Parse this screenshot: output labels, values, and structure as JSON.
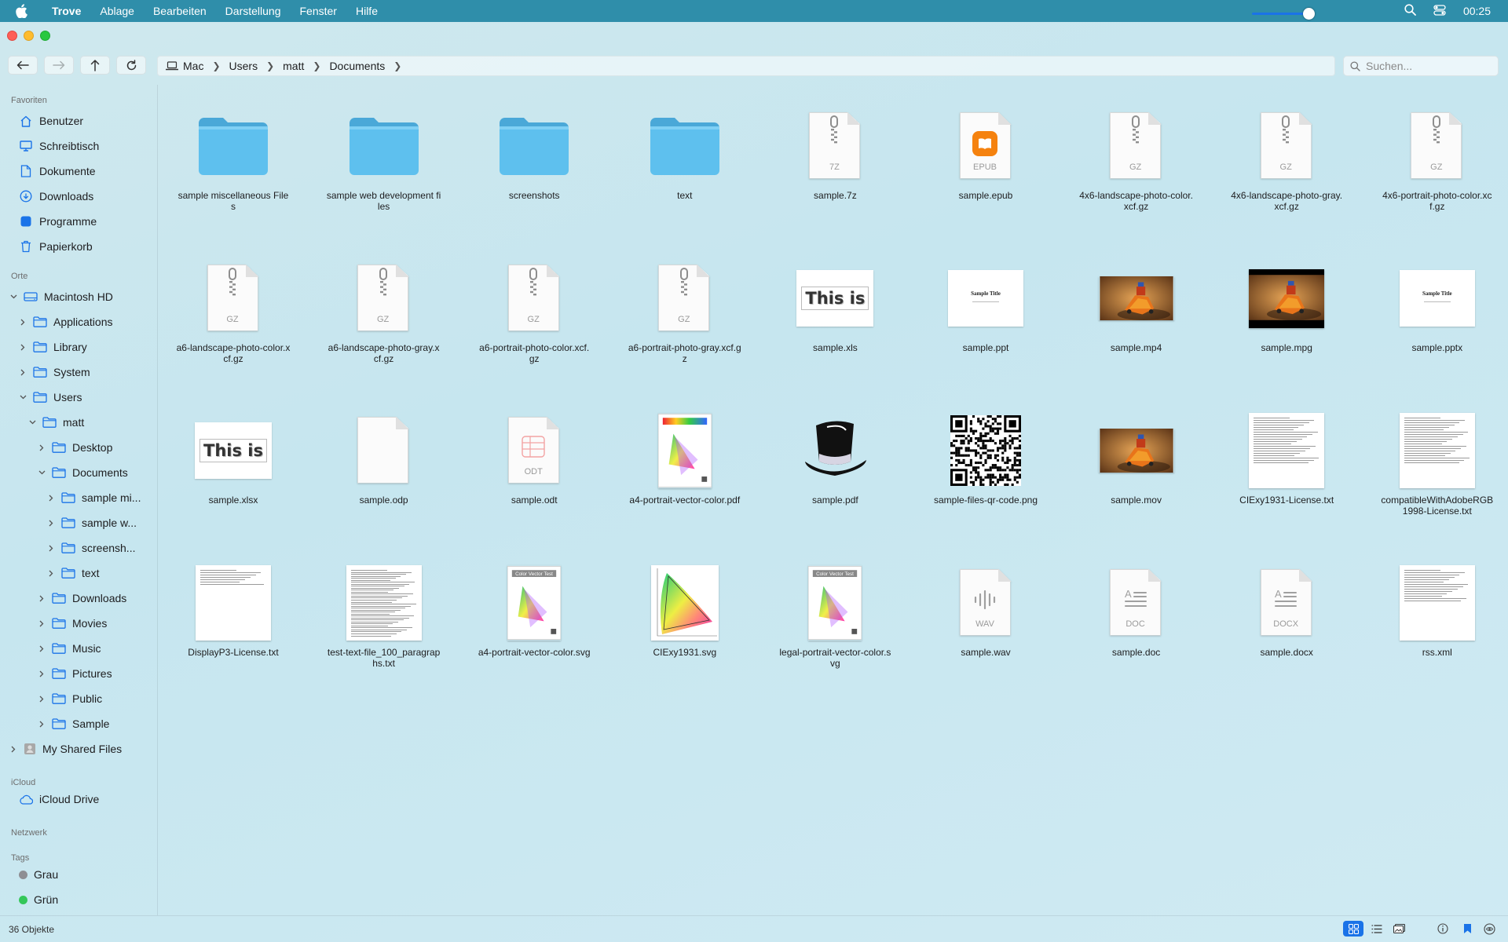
{
  "menubar": {
    "app_name": "Trove",
    "items": [
      "Ablage",
      "Bearbeiten",
      "Darstellung",
      "Fenster",
      "Hilfe"
    ],
    "clock": "00:25"
  },
  "pathbar": {
    "crumbs": [
      "Mac",
      "Users",
      "matt",
      "Documents"
    ]
  },
  "search": {
    "placeholder": "Suchen..."
  },
  "sidebar": {
    "sections": {
      "favorites": "Favoriten",
      "places": "Orte",
      "icloud": "iCloud",
      "network": "Netzwerk",
      "tags": "Tags"
    },
    "favorites": [
      {
        "label": "Benutzer",
        "icon": "house-icon"
      },
      {
        "label": "Schreibtisch",
        "icon": "desktop-icon"
      },
      {
        "label": "Dokumente",
        "icon": "document-icon"
      },
      {
        "label": "Downloads",
        "icon": "download-icon"
      },
      {
        "label": "Programme",
        "icon": "apps-icon"
      },
      {
        "label": "Papierkorb",
        "icon": "trash-icon"
      }
    ],
    "places": [
      {
        "label": "Macintosh HD"
      },
      {
        "label": "Applications"
      },
      {
        "label": "Library"
      },
      {
        "label": "System"
      },
      {
        "label": "Users"
      },
      {
        "label": "matt"
      },
      {
        "label": "Desktop"
      },
      {
        "label": "Documents"
      },
      {
        "label": "sample mi..."
      },
      {
        "label": "sample w..."
      },
      {
        "label": "screensh..."
      },
      {
        "label": "text"
      },
      {
        "label": "Downloads"
      },
      {
        "label": "Movies"
      },
      {
        "label": "Music"
      },
      {
        "label": "Pictures"
      },
      {
        "label": "Public"
      },
      {
        "label": "Sample"
      },
      {
        "label": "My Shared Files"
      }
    ],
    "icloud": [
      {
        "label": "iCloud Drive"
      }
    ],
    "tags": [
      {
        "label": "Grau",
        "color": "#8e8e93"
      },
      {
        "label": "Grün",
        "color": "#34c759"
      }
    ]
  },
  "files": [
    {
      "name": "sample miscellaneous Files",
      "kind": "folder"
    },
    {
      "name": "sample web development files",
      "kind": "folder"
    },
    {
      "name": "screenshots",
      "kind": "folder"
    },
    {
      "name": "text",
      "kind": "folder"
    },
    {
      "name": "sample.7z",
      "kind": "zip",
      "ext": "7Z"
    },
    {
      "name": "sample.epub",
      "kind": "epub",
      "ext": "EPUB"
    },
    {
      "name": "4x6-landscape-photo-color.xcf.gz",
      "kind": "zip",
      "ext": "GZ"
    },
    {
      "name": "4x6-landscape-photo-gray.xcf.gz",
      "kind": "zip",
      "ext": "GZ"
    },
    {
      "name": "4x6-portrait-photo-color.xcf.gz",
      "kind": "zip",
      "ext": "GZ"
    },
    {
      "name": "a6-landscape-photo-color.xcf.gz",
      "kind": "zip",
      "ext": "GZ"
    },
    {
      "name": "a6-landscape-photo-gray.xcf.gz",
      "kind": "zip",
      "ext": "GZ"
    },
    {
      "name": "a6-portrait-photo-color.xcf.gz",
      "kind": "zip",
      "ext": "GZ"
    },
    {
      "name": "a6-portrait-photo-gray.xcf.gz",
      "kind": "zip",
      "ext": "GZ"
    },
    {
      "name": "sample.xls",
      "kind": "thisis",
      "thumb_text": "This is"
    },
    {
      "name": "sample.ppt",
      "kind": "slide",
      "thumb_text": "Sample Title"
    },
    {
      "name": "sample.mp4",
      "kind": "photo"
    },
    {
      "name": "sample.mpg",
      "kind": "photo"
    },
    {
      "name": "sample.pptx",
      "kind": "slide",
      "thumb_text": "Sample Title"
    },
    {
      "name": "sample.xlsx",
      "kind": "thisis",
      "thumb_text": "This is"
    },
    {
      "name": "sample.odp",
      "kind": "blank"
    },
    {
      "name": "sample.odt",
      "kind": "odt",
      "ext": "ODT"
    },
    {
      "name": "a4-portrait-vector-color.pdf",
      "kind": "gamut"
    },
    {
      "name": "sample.pdf",
      "kind": "hat"
    },
    {
      "name": "sample-files-qr-code.png",
      "kind": "qr"
    },
    {
      "name": "sample.mov",
      "kind": "photo"
    },
    {
      "name": "CIExy1931-License.txt",
      "kind": "text"
    },
    {
      "name": "compatibleWithAdobeRGB1998-License.txt",
      "kind": "text"
    },
    {
      "name": "DisplayP3-License.txt",
      "kind": "text"
    },
    {
      "name": "test-text-file_100_paragraphs.txt",
      "kind": "text"
    },
    {
      "name": "a4-portrait-vector-color.svg",
      "kind": "gamut"
    },
    {
      "name": "CIExy1931.svg",
      "kind": "cie"
    },
    {
      "name": "legal-portrait-vector-color.svg",
      "kind": "gamut"
    },
    {
      "name": "sample.wav",
      "kind": "wav",
      "ext": "WAV"
    },
    {
      "name": "sample.doc",
      "kind": "docfile",
      "ext": "DOC"
    },
    {
      "name": "sample.docx",
      "kind": "docfile",
      "ext": "DOCX"
    },
    {
      "name": "rss.xml",
      "kind": "text"
    }
  ],
  "status": {
    "count": "36 Objekte",
    "zoom_level": 0.85
  },
  "colors": {
    "menubar": "#2f8eaa",
    "accent": "#1a73e8",
    "folder": "#5ec0ee"
  }
}
